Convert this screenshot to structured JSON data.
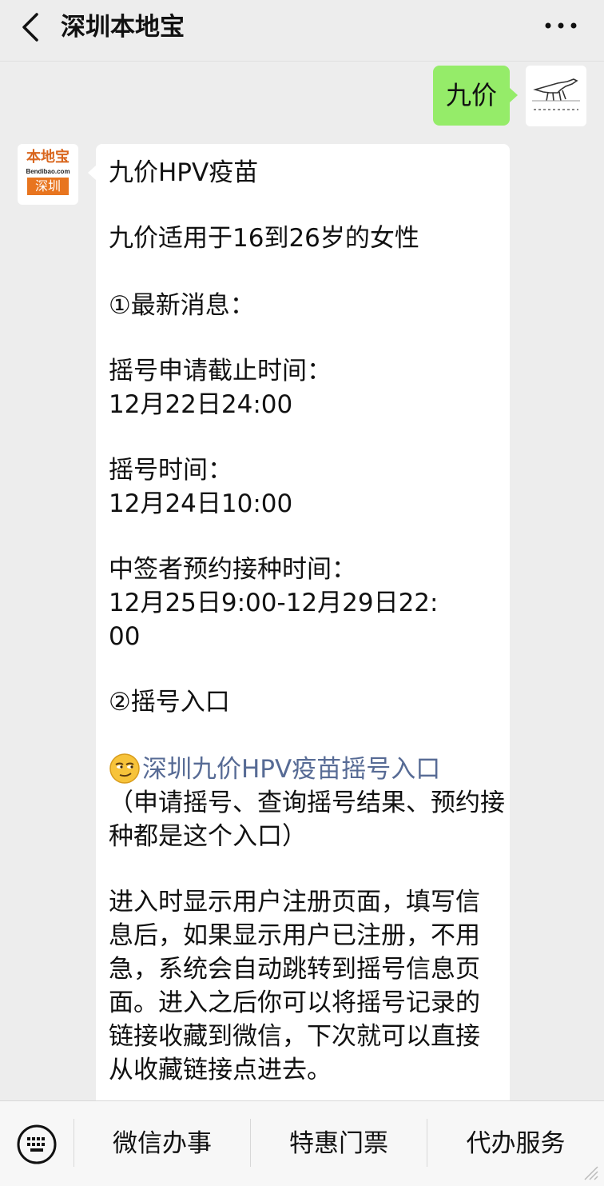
{
  "header": {
    "title": "深圳本地宝",
    "back_icon": "chevron-left-icon",
    "more_icon": "more-dots-icon"
  },
  "outgoing": {
    "text": "九价"
  },
  "avatar_bdb": {
    "brand": "本地宝",
    "site": "Bendibao.com",
    "city": "深圳"
  },
  "message": {
    "title": "九价HPV疫苗",
    "applies": "九价适用于16到26岁的女性",
    "section1": "①最新消息：",
    "lottery_deadline_label": "摇号申请截止时间：",
    "lottery_deadline_value": "12月22日24:00",
    "lottery_time_label": "摇号时间：",
    "lottery_time_value": "12月24日10:00",
    "appointment_label": "中签者预约接种时间：",
    "appointment_value_line1": "12月25日9:00-12月29日22:",
    "appointment_value_line2": "00",
    "section2": "②摇号入口",
    "entry_link": "深圳九价HPV疫苗摇号入口",
    "entry_note_line1": "（申请摇号、查询摇号结果、预约接",
    "entry_note_line2": "种都是这个入口）",
    "para_line1": "进入时显示用户注册页面，填写信",
    "para_line2": "息后，如果显示用户已注册，不用",
    "para_line3": "急，系统会自动跳转到摇号信息页",
    "para_line4": "面。进入之后你可以将摇号记录的",
    "para_line5": "链接收藏到微信，下次就可以直接",
    "para_line6": "从收藏链接点进去。"
  },
  "bottom_menu": {
    "keyboard_icon": "keyboard-icon",
    "items": [
      {
        "label": "微信办事"
      },
      {
        "label": "特惠门票"
      },
      {
        "label": "代办服务"
      }
    ]
  },
  "colors": {
    "background": "#ededed",
    "outgoing_bubble": "#95ec69",
    "incoming_bubble": "#ffffff",
    "link": "#576b95",
    "brand_orange": "#e8751f"
  }
}
